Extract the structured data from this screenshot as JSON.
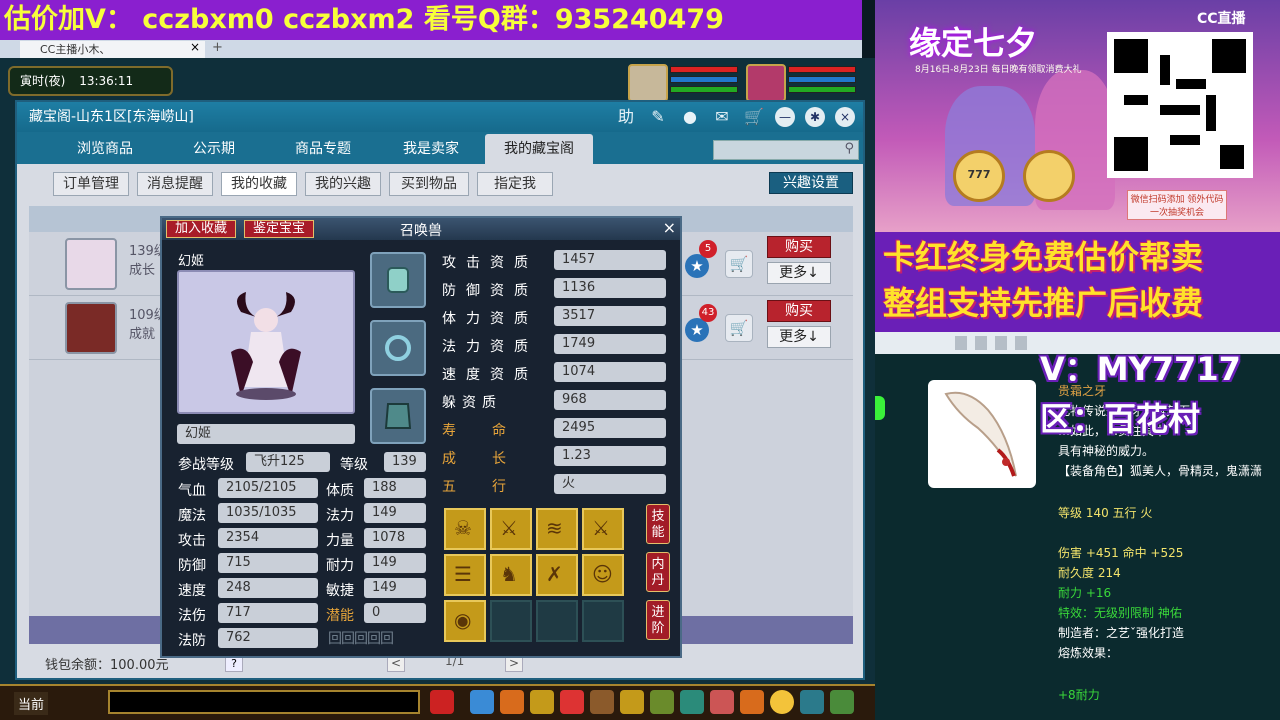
{
  "banner": {
    "text": "估价加V： cczbxm0   cczbxm2   看号Q群：935240479"
  },
  "browser": {
    "tab_title": "CC主播小木、",
    "close": "×",
    "plus": "+"
  },
  "hud": {
    "period": "寅时(夜)",
    "time": "13:36:11"
  },
  "window": {
    "title": "藏宝阁-山东1区[东海崂山]",
    "icons": {
      "help": "助",
      "pin": "✎",
      "rec": "●",
      "chat": "✉",
      "cart": "🛒",
      "min": "—",
      "settings": "✱",
      "close": "×"
    },
    "nav": [
      "浏览商品",
      "公示期",
      "商品专题",
      "我是卖家",
      "我的藏宝阁"
    ],
    "subtabs": [
      "订单管理",
      "消息提醒",
      "我的收藏",
      "我的兴趣",
      "买到物品",
      "指定我"
    ],
    "interest_btn": "兴趣设置",
    "rows": [
      {
        "text1": "139级",
        "text2": "成长",
        "badge": "5",
        "buy": "购买",
        "more": "更多↓"
      },
      {
        "text1": "109级",
        "text2": "成就",
        "badge": "43",
        "buy": "购买",
        "more": "更多↓"
      }
    ],
    "wallet": "钱包余额：100.00元",
    "page": "1/1",
    "help": "?",
    "prev": "<",
    "next": ">"
  },
  "popup": {
    "btn_fav": "加入收藏",
    "btn_appraise": "鉴定宝宝",
    "title": "召唤兽",
    "close": "×",
    "pet_name": "幻姬",
    "pet_namefield": "幻姬",
    "level_label": "参战等级",
    "level_value": "飞升125",
    "grade_label": "等级",
    "grade_value": "139",
    "left_stats": [
      {
        "label": "气血",
        "value": "2105/2105",
        "label2": "体质",
        "value2": "188"
      },
      {
        "label": "魔法",
        "value": "1035/1035",
        "label2": "法力",
        "value2": "149"
      },
      {
        "label": "攻击",
        "value": "2354",
        "label2": "力量",
        "value2": "1078"
      },
      {
        "label": "防御",
        "value": "715",
        "label2": "耐力",
        "value2": "149"
      },
      {
        "label": "速度",
        "value": "248",
        "label2": "敏捷",
        "value2": "149"
      },
      {
        "label": "法伤",
        "value": "717",
        "label2": "潜能",
        "value2": "0"
      },
      {
        "label": "法防",
        "value": "762"
      }
    ],
    "right_stats": [
      {
        "label": "攻击资质",
        "value": "1457"
      },
      {
        "label": "防御资质",
        "value": "1136"
      },
      {
        "label": "体力资质",
        "value": "3517"
      },
      {
        "label": "法力资质",
        "value": "1749"
      },
      {
        "label": "速度资质",
        "value": "1074"
      },
      {
        "label": "躲资质",
        "value": "968"
      }
    ],
    "gold_stats": [
      {
        "label": "寿命",
        "value": "2495"
      },
      {
        "label": "成长",
        "value": "1.23"
      },
      {
        "label": "五行",
        "value": "火"
      }
    ],
    "side_buttons": [
      "技能",
      "内丹",
      "进阶"
    ],
    "skill_glyphs": [
      "☠",
      "⚔",
      "≋",
      "⚔",
      "☰",
      "♞",
      "✗",
      "☺",
      "◉"
    ]
  },
  "bottom": {
    "channel": "当前"
  },
  "right_panel": {
    "event_title": "缘定七夕",
    "event_sub": "8月16日-8月23日 每日晚有领取消费大礼",
    "cc_logo": "CC直播",
    "medal1": "777",
    "medal2": "",
    "note": "微信扫码添加 领外代码一次抽奖机会",
    "ad_line1": "卡红终身免费估价帮卖",
    "ad_line2": "整组支持先推广后收费",
    "v_text": "V：MY7717",
    "q_text": "区：百花村",
    "item_title": "贵霜之牙",
    "item_desc": [
      "此物传说是…牙所雕刻而",
      "…如此，…贯注其中",
      "具有神秘的威力。",
      "【装备角色】狐美人，骨精灵，鬼潇潇"
    ],
    "item_level": "等级 140 五行 火",
    "item_dmg": "伤害 +451 命中 +525",
    "item_dur": "耐久度 214",
    "item_nl": "耐力 +16",
    "item_special": "特效：无级别限制 神佑",
    "item_maker": "制造者：之艺ˇ强化打造",
    "item_effect": "熔炼效果：",
    "item_plus": "+8耐力",
    "colors": {
      "banner_bg": "#8a1fcf",
      "banner_fg": "#f7ff3a",
      "buy": "#b8232d",
      "ad_bg": "#6a1fb7",
      "ad_fg": "#ffe22a"
    }
  }
}
